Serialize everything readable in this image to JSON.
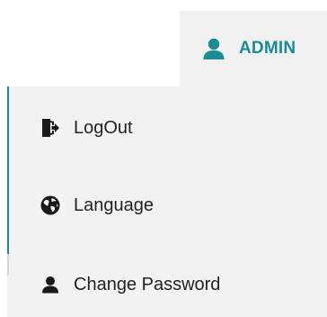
{
  "colors": {
    "accent": "#1a8c96",
    "text": "#222222",
    "icon": "#1a1a1a",
    "header_bg": "#f0f0f0",
    "menu_bg": "#f2f2f2"
  },
  "header": {
    "username": "ADMIN",
    "icon": "user-icon"
  },
  "menu": {
    "items": [
      {
        "label": "LogOut",
        "icon": "logout-icon"
      },
      {
        "label": "Language",
        "icon": "globe-icon"
      },
      {
        "label": "Change Password",
        "icon": "user-icon"
      }
    ]
  }
}
